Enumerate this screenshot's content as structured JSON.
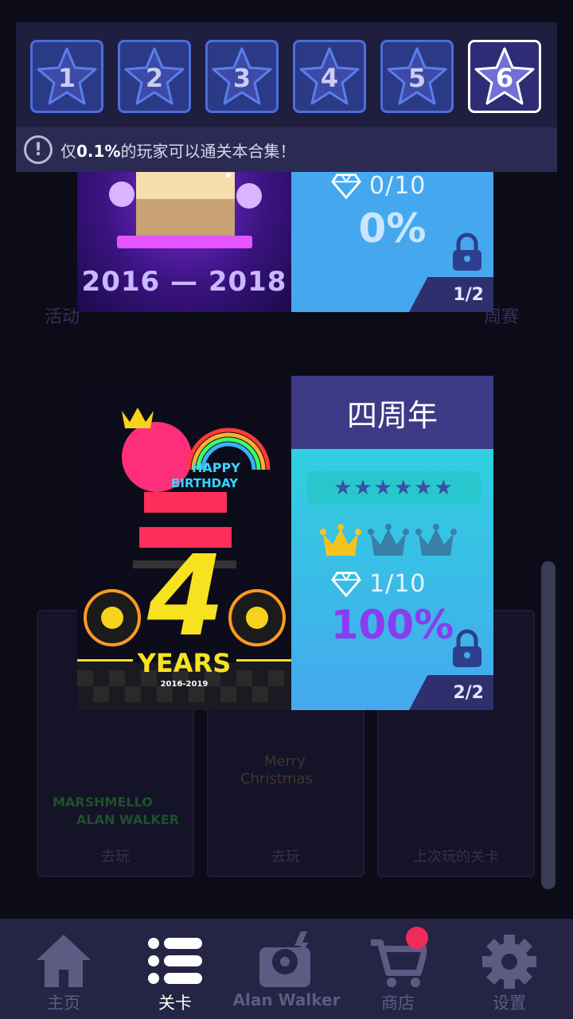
{
  "levels": [
    {
      "label": "1",
      "active": false
    },
    {
      "label": "2",
      "active": false
    },
    {
      "label": "3",
      "active": false
    },
    {
      "label": "4",
      "active": false
    },
    {
      "label": "5",
      "active": false
    },
    {
      "label": "6",
      "active": true
    }
  ],
  "notice": {
    "prefix": "仅",
    "highlight": "0.1%",
    "suffix": "的玩家可以通关本合集！"
  },
  "background": {
    "side_left": "活动",
    "side_right": "周赛",
    "panel_labels": [
      "去玩",
      "去玩",
      "上次玩的关卡"
    ],
    "panel_art_texts": [
      "MARSHMELLO",
      "ALAN WALKER",
      "Merry",
      "Christmas"
    ]
  },
  "card_top": {
    "image_caption": "2016 — 2018",
    "diamonds": "0/10",
    "percent": "0%",
    "page": "1/2"
  },
  "card_main": {
    "title": "四周年",
    "stars": "★★★★★★",
    "crowns_earned": 1,
    "crowns_total": 3,
    "diamonds": "1/10",
    "percent": "100%",
    "page": "2/2",
    "image_texts": {
      "happy": "HAPPY",
      "birthday": "BIRTHDAY",
      "number": "4",
      "years": "YEARS",
      "range": "2016-2019"
    }
  },
  "bottom_nav": [
    {
      "label": "主页",
      "icon": "home-icon",
      "active": false
    },
    {
      "label": "关卡",
      "icon": "levels-list-icon",
      "active": true
    },
    {
      "label": "Alan Walker",
      "icon": "music-player-icon",
      "active": false
    },
    {
      "label": "商店",
      "icon": "shop-cart-icon",
      "active": false,
      "badge": true
    },
    {
      "label": "设置",
      "icon": "gear-icon",
      "active": false
    }
  ],
  "colors": {
    "accent_blue": "#45a8ee",
    "title_bar": "#3d3a86",
    "percent_purple": "#8a3cf0",
    "crown_gold": "#f7c21f",
    "badge_red": "#ef2b5a"
  }
}
